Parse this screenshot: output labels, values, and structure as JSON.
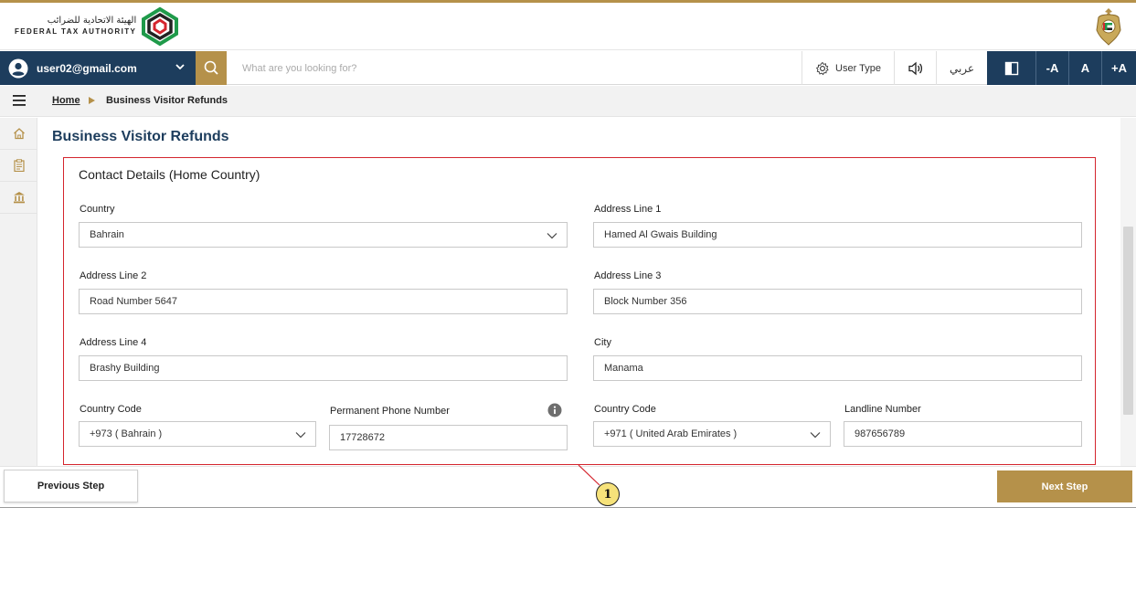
{
  "header": {
    "logo_arabic": "الهيئة الاتحادية للضرائب",
    "logo_english": "FEDERAL TAX AUTHORITY",
    "emblem_icon": "uae-emblem-icon"
  },
  "toolbar": {
    "user_email": "user02@gmail.com",
    "search_placeholder": "What are you looking for?",
    "user_type_label": "User Type",
    "language_label": "عربي",
    "font_decrease": "-A",
    "font_default": "A",
    "font_increase": "+A"
  },
  "breadcrumb": {
    "home": "Home",
    "current": "Business Visitor Refunds"
  },
  "page": {
    "title": "Business Visitor Refunds",
    "section_title": "Contact Details (Home Country)"
  },
  "form": {
    "country_label": "Country",
    "country_value": "Bahrain",
    "address1_label": "Address Line 1",
    "address1_value": "Hamed Al Gwais Building",
    "address2_label": "Address Line 2",
    "address2_value": "Road Number 5647",
    "address3_label": "Address Line 3",
    "address3_value": "Block Number 356",
    "address4_label": "Address Line 4",
    "address4_value": "Brashy Building",
    "city_label": "City",
    "city_value": "Manama",
    "country_code_label": "Country Code",
    "country_code_value": "+973 ( Bahrain )",
    "phone_label": "Permanent Phone Number",
    "phone_value": "17728672",
    "country_code2_label": "Country Code",
    "country_code2_value": "+971 ( United Arab Emirates )",
    "landline_label": "Landline Number",
    "landline_value": "987656789"
  },
  "footer": {
    "previous_label": "Previous Step",
    "next_label": "Next Step"
  },
  "annotation": {
    "badge_number": "1"
  },
  "colors": {
    "brand_navy": "#1d3d5d",
    "brand_gold": "#b5914a",
    "highlight_red": "#d4252e"
  }
}
